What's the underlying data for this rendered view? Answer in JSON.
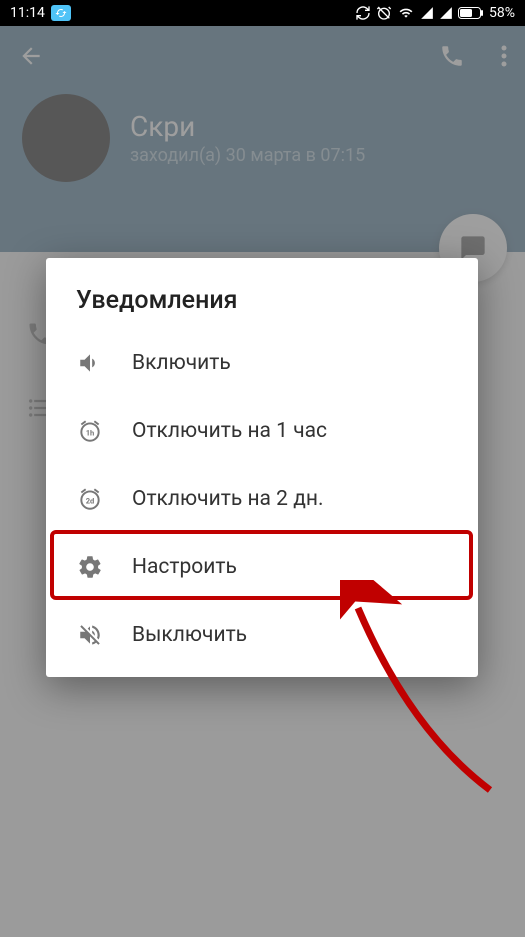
{
  "statusbar": {
    "time": "11:14",
    "battery": "58%"
  },
  "profile": {
    "name": "Скри",
    "status": "заходил(а) 30 марта в 07:15"
  },
  "dialog": {
    "title": "Уведомления",
    "items": [
      {
        "label": "Включить"
      },
      {
        "label": "Отключить на 1 час"
      },
      {
        "label": "Отключить на 2 дн."
      },
      {
        "label": "Настроить"
      },
      {
        "label": "Выключить"
      }
    ]
  }
}
